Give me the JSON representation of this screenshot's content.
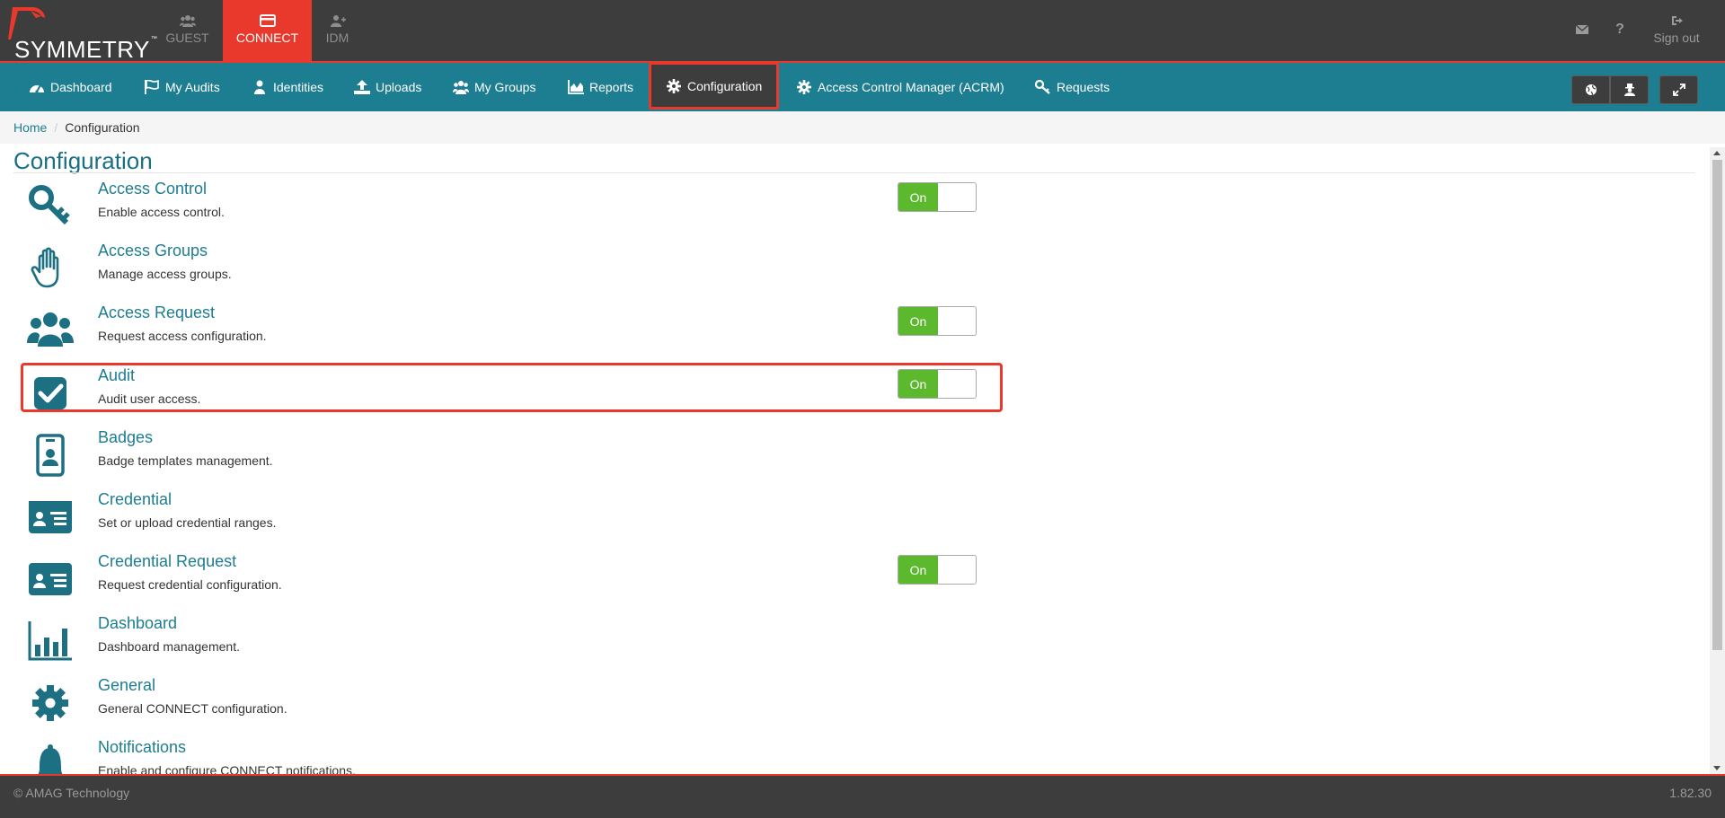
{
  "app": {
    "logo_text": "SYMMETRY",
    "tabs": [
      {
        "label": "GUEST",
        "icon": "users-icon",
        "active": false
      },
      {
        "label": "CONNECT",
        "icon": "credit-card-icon",
        "active": true
      },
      {
        "label": "IDM",
        "icon": "user-plus-icon",
        "active": false
      }
    ],
    "signout_label": "Sign out"
  },
  "nav": {
    "items": [
      {
        "label": "Dashboard",
        "icon": "dashboard-icon"
      },
      {
        "label": "My Audits",
        "icon": "flag-icon"
      },
      {
        "label": "Identities",
        "icon": "user-icon"
      },
      {
        "label": "Uploads",
        "icon": "upload-icon"
      },
      {
        "label": "My Groups",
        "icon": "group-icon"
      },
      {
        "label": "Reports",
        "icon": "area-chart-icon"
      },
      {
        "label": "Configuration",
        "icon": "gear-icon",
        "active": true
      },
      {
        "label": "Access Control Manager (ACRM)",
        "icon": "gear-icon"
      },
      {
        "label": "Requests",
        "icon": "key-icon"
      }
    ]
  },
  "breadcrumb": {
    "home": "Home",
    "separator": "/",
    "current": "Configuration"
  },
  "page": {
    "title": "Configuration"
  },
  "config_items": [
    {
      "name": "Access Control",
      "desc": "Enable access control.",
      "icon": "key-icon",
      "toggle": "On"
    },
    {
      "name": "Access Groups",
      "desc": "Manage access groups.",
      "icon": "hand-icon",
      "toggle": null
    },
    {
      "name": "Access Request",
      "desc": "Request access configuration.",
      "icon": "users-icon",
      "toggle": "On"
    },
    {
      "name": "Audit",
      "desc": "Audit user access.",
      "icon": "check-square-icon",
      "toggle": "On",
      "highlighted": true
    },
    {
      "name": "Badges",
      "desc": "Badge templates management.",
      "icon": "badge-icon",
      "toggle": null
    },
    {
      "name": "Credential",
      "desc": "Set or upload credential ranges.",
      "icon": "id-card-icon",
      "toggle": null
    },
    {
      "name": "Credential Request",
      "desc": "Request credential configuration.",
      "icon": "id-card-icon",
      "toggle": "On"
    },
    {
      "name": "Dashboard",
      "desc": "Dashboard management.",
      "icon": "bar-chart-icon",
      "toggle": null
    },
    {
      "name": "General",
      "desc": "General CONNECT configuration.",
      "icon": "gear-icon",
      "toggle": null
    },
    {
      "name": "Notifications",
      "desc": "Enable and configure CONNECT notifications.",
      "icon": "bell-icon",
      "toggle": null
    }
  ],
  "footer": {
    "copyright": "© AMAG Technology",
    "version": "1.82.30"
  },
  "colors": {
    "brand_red": "#e8392c",
    "nav_teal": "#1d7d91",
    "dark_bar": "#3d3d3d",
    "toggle_on": "#5cb82c"
  }
}
